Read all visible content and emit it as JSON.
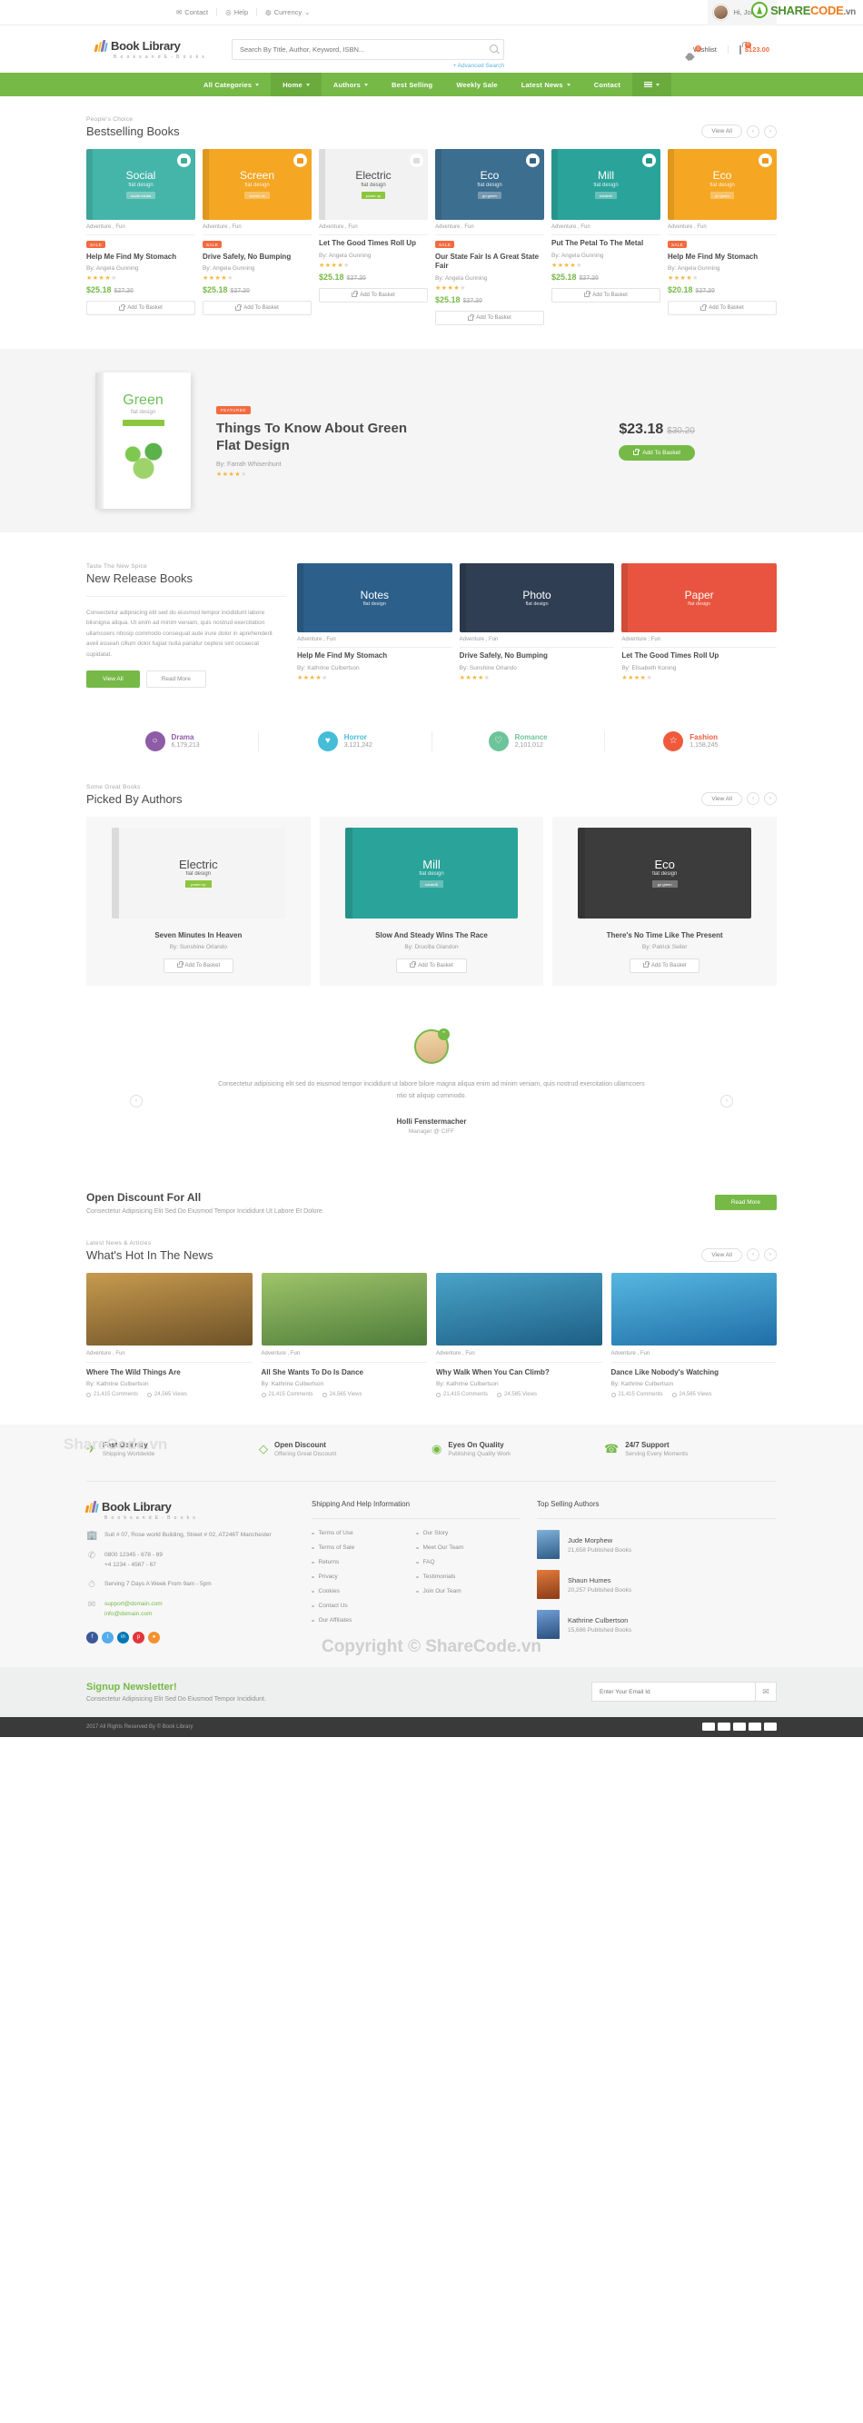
{
  "topbar": {
    "links": [
      {
        "label": "Contact",
        "icon": "envelope-icon"
      },
      {
        "label": "Help",
        "icon": "question-circle-icon"
      },
      {
        "label": "Currency",
        "icon": "globe-icon"
      }
    ],
    "user": "Hi, John",
    "sharecode": {
      "green": "SHARE",
      "orange": "CODE",
      "suffix": ".vn"
    }
  },
  "header": {
    "brand": "Book Library",
    "brand_sub": "B o o k s   a n d   E - B o o k s",
    "search_placeholder": "Search By Title, Author, Keyword, ISBN...",
    "advanced_search": "+ Advanced Search",
    "wishlist_label": "Wishlist",
    "wishlist_count": "0",
    "cart_count": "0",
    "cart_total": "$123.00"
  },
  "nav": {
    "items": [
      {
        "label": "All Categories",
        "caret": true,
        "active": false
      },
      {
        "label": "Home",
        "caret": true,
        "active": true
      },
      {
        "label": "Authors",
        "caret": true,
        "active": false
      },
      {
        "label": "Best Selling",
        "caret": false,
        "active": false
      },
      {
        "label": "Weekly Sale",
        "caret": false,
        "active": false
      },
      {
        "label": "Latest News",
        "caret": true,
        "active": false
      },
      {
        "label": "Contact",
        "caret": false,
        "active": false
      }
    ],
    "burger_caret": true
  },
  "bestselling": {
    "eyebrow": "People's Choice",
    "title": "Bestselling Books",
    "view_all": "View All",
    "prev": "‹",
    "next": "›",
    "products": [
      {
        "cover_title": "Social",
        "cover_sub": "flat design",
        "cover_badge": "social media",
        "bg": "#45b5aa",
        "badge_color": "#3fae9f",
        "category": "Adventure , Fun",
        "sale": "SALE",
        "title": "Help Me Find My Stomach",
        "author": "By: Angela Gunning",
        "rating": 4,
        "price": "$25.18",
        "old_price": "$27.20",
        "cta": "Add To Basket"
      },
      {
        "cover_title": "Screen",
        "cover_sub": "flat design",
        "cover_badge": "screen ux",
        "bg": "#f5a623",
        "badge_color": "#f0971a",
        "category": "Adventure , Fun",
        "sale": "SALE",
        "title": "Drive Safely, No Bumping",
        "author": "By: Angela Gunning",
        "rating": 4,
        "price": "$25.18",
        "old_price": "$27.20",
        "cta": "Add To Basket"
      },
      {
        "cover_title": "Electric",
        "cover_sub": "flat design",
        "cover_badge": "power up",
        "bg": "#f2f2f2",
        "badge_color": "#dcdcdc",
        "category": "Adventure , Fun",
        "sale": "",
        "title": "Let The Good Times Roll Up",
        "author": "By: Angela Gunning",
        "rating": 4,
        "price": "$25.18",
        "old_price": "$27.20",
        "cta": "Add To Basket"
      },
      {
        "cover_title": "Eco",
        "cover_sub": "flat design",
        "cover_badge": "go green",
        "bg": "#3c6e8f",
        "badge_color": "#35637f",
        "category": "Adventure , Fun",
        "sale": "SALE",
        "title": "Our State Fair Is A Great State Fair",
        "author": "By: Angela Gunning",
        "rating": 4,
        "price": "$25.18",
        "old_price": "$27.20",
        "cta": "Add To Basket"
      },
      {
        "cover_title": "Mill",
        "cover_sub": "flat design",
        "cover_badge": "windmill",
        "bg": "#2aa39a",
        "badge_color": "#25948c",
        "category": "Adventure , Fun",
        "sale": "",
        "title": "Put The Petal To The Metal",
        "author": "By: Angela Gunning",
        "rating": 4,
        "price": "$25.18",
        "old_price": "$27.20",
        "cta": "Add To Basket"
      },
      {
        "cover_title": "Eco",
        "cover_sub": "flat design",
        "cover_badge": "go green",
        "bg": "#f5a623",
        "badge_color": "#f0971a",
        "category": "Adventure , Fun",
        "sale": "SALE",
        "title": "Help Me Find My Stomach",
        "author": "By: Angela Gunning",
        "rating": 4,
        "price": "$20.18",
        "old_price": "$27.20",
        "cta": "Add To Basket"
      }
    ]
  },
  "feature": {
    "tag": "FEATURED",
    "title": "Things To Know About Green Flat Design",
    "author": "By: Farrah Whisenhunt",
    "rating": 4,
    "price": "$23.18",
    "old_price": "$30.20",
    "cta": "Add To Basket",
    "cover_title": "Green",
    "cover_sub": "flat design",
    "cover_badge": "eco friendly"
  },
  "newrelease": {
    "eyebrow": "Taste The New Spice",
    "title": "New Release Books",
    "description": "Consectetur adipisicing elit sed do eiusmod tempor incididunt labore bilonigna aliqua. Ut enim ad minim veniam, quis nostrud exercitation ullamcoers ntiosip commodo consequat aute irure dolor in aprehenderit aveli esseah cillum dolor fugiat nulla pariatur ceptesi sint occaecat cupidatat.",
    "btn_primary": "View All",
    "btn_secondary": "Read More",
    "books": [
      {
        "cover_title": "Notes",
        "cover_sub": "flat design",
        "bg": "#2c5f8a",
        "category": "Adventure , Fun",
        "title": "Help Me Find My Stomach",
        "author": "By: Kathrine Culbertson",
        "rating": 4
      },
      {
        "cover_title": "Photo",
        "cover_sub": "flat design",
        "bg": "#2f3e52",
        "category": "Adventure , Fun",
        "title": "Drive Safely, No Bumping",
        "author": "By: Sunshine Orlando",
        "rating": 4
      },
      {
        "cover_title": "Paper",
        "cover_sub": "flat design",
        "bg": "#e8543f",
        "category": "Adventure , Fun",
        "title": "Let The Good Times Roll Up",
        "author": "By: Elisabeth Koning",
        "rating": 4
      }
    ]
  },
  "stats": [
    {
      "name": "Drama",
      "count": "6,179,213",
      "color": "#8e5ba6",
      "icon": "chat-bubble-icon",
      "glyph": "○"
    },
    {
      "name": "Horror",
      "count": "3,121,242",
      "color": "#45bcd8",
      "icon": "heartbeat-icon",
      "glyph": "♥"
    },
    {
      "name": "Romance",
      "count": "2,101,012",
      "color": "#6dc49a",
      "icon": "heart-icon",
      "glyph": "♡"
    },
    {
      "name": "Fashion",
      "count": "1,158,245",
      "color": "#ef5a3d",
      "icon": "star-icon",
      "glyph": "☆"
    }
  ],
  "picked": {
    "eyebrow": "Some Great Books",
    "title": "Picked By Authors",
    "view_all": "View All",
    "books": [
      {
        "cover_title": "Electric",
        "cover_sub": "flat design",
        "cover_badge": "power up",
        "bg": "#f4f4f4",
        "title": "Seven Minutes In Heaven",
        "author": "By: Sunshine Orlando",
        "cta": "Add To Basket"
      },
      {
        "cover_title": "Mill",
        "cover_sub": "flat design",
        "cover_badge": "windmill",
        "bg": "#2aa39a",
        "title": "Slow And Steady Wins The Race",
        "author": "By: Drucilla Glandon",
        "cta": "Add To Basket"
      },
      {
        "cover_title": "Eco",
        "cover_sub": "flat design",
        "cover_badge": "go green",
        "bg": "#3c3c3c",
        "title": "There's No Time Like The Present",
        "author": "By: Patrick Seiler",
        "cta": "Add To Basket"
      }
    ]
  },
  "testimonial": {
    "quote_mark": "”",
    "text": "Consectetur adipisicing elit sed do eiusmod tempor incididunt ut labore bilore magna aliqua enim ad minim veniam, quis nostrud exercitation ullamcoers ntio sit aliquip commodo.",
    "name": "Holli Fenstermacher",
    "role": "Manager @ CIFF",
    "prev": "‹",
    "next": "›"
  },
  "discount": {
    "title": "Open Discount For All",
    "subtitle": "Consectetur Adipisicing Elit Sed Do Eiusmod Tempor Incididunt Ut Labore Et Dolore.",
    "cta": "Read More"
  },
  "news": {
    "eyebrow": "Latest News & Articles",
    "title": "What's Hot In The News",
    "view_all": "View All",
    "articles": [
      {
        "bg": "linear-gradient(170deg,#c79a4e,#6e5228)",
        "category": "Adventure , Fun",
        "title": "Where The Wild Things Are",
        "author": "By: Kathrine Culbertson",
        "comments": "21,415 Comments",
        "views": "24,565 Views"
      },
      {
        "bg": "linear-gradient(170deg,#9fc46a,#4e7c3a)",
        "category": "Adventure , Fun",
        "title": "All She Wants To Do Is Dance",
        "author": "By: Kathrine Culbertson",
        "comments": "21,415 Comments",
        "views": "24,565 Views"
      },
      {
        "bg": "linear-gradient(170deg,#4aa3c9,#1d5f85)",
        "category": "Adventure , Fun",
        "title": "Why Walk When You Can Climb?",
        "author": "By: Kathrine Culbertson",
        "comments": "21,415 Comments",
        "views": "24,565 Views"
      },
      {
        "bg": "linear-gradient(170deg,#57b7e0,#1f6fa8)",
        "category": "Adventure , Fun",
        "title": "Dance Like Nobody's Watching",
        "author": "By: Kathrine Culbertson",
        "comments": "21,415 Comments",
        "views": "24,565 Views"
      }
    ]
  },
  "services": {
    "watermark": "ShareCode.vn",
    "items": [
      {
        "icon": "rocket-icon",
        "glyph": "✈",
        "title": "Fast Delivery",
        "sub": "Shipping Worldwide"
      },
      {
        "icon": "tag-icon",
        "glyph": "◇",
        "title": "Open Discount",
        "sub": "Offering Great Discount"
      },
      {
        "icon": "eye-icon",
        "glyph": "◉",
        "title": "Eyes On Quality",
        "sub": "Publishing Quality Work"
      },
      {
        "icon": "support-icon",
        "glyph": "☎",
        "title": "24/7 Support",
        "sub": "Serving Every Moments"
      }
    ]
  },
  "footer": {
    "watermark": "Copyright © ShareCode.vn",
    "brand": "Book Library",
    "brand_sub": "B o o k s   a n d   E - B o o k s",
    "address": "Suit # 07, Rose world Building, Street # 02, AT246T Manchester",
    "phone1": "0800 12345 - 678 - 89",
    "phone2": "+4 1234 - 4567 - 67",
    "hours": "Serving 7 Days A Week From 9am - 5pm",
    "email1": "support@domain.com",
    "email2": "info@domain.com",
    "socials": [
      {
        "name": "facebook-icon",
        "glyph": "f",
        "color": "#3b5998"
      },
      {
        "name": "twitter-icon",
        "glyph": "t",
        "color": "#55acee"
      },
      {
        "name": "linkedin-icon",
        "glyph": "in",
        "color": "#0077b5"
      },
      {
        "name": "pinterest-icon",
        "glyph": "p",
        "color": "#e3353b"
      },
      {
        "name": "rss-icon",
        "glyph": "●",
        "color": "#f5922f"
      }
    ],
    "shipping_head": "Shipping And Help Information",
    "links_col1": [
      "Terms of Use",
      "Terms of Sale",
      "Returns",
      "Privacy",
      "Cookies",
      "Contact Us",
      "Our Affiliates"
    ],
    "links_col2": [
      "Our Story",
      "Meet Our Team",
      "FAQ",
      "Testimonials",
      "Join Our Team"
    ],
    "authors_head": "Top Selling Authors",
    "authors": [
      {
        "name": "Jude Morphew",
        "books": "21,658 Published Books",
        "color": "linear-gradient(170deg,#7fb0d8,#2e5c86)"
      },
      {
        "name": "Shaun Humes",
        "books": "20,257 Published Books",
        "color": "linear-gradient(170deg,#e07a3c,#8a3c18)"
      },
      {
        "name": "Kathrine Culbertson",
        "books": "15,686 Published Books",
        "color": "linear-gradient(170deg,#6f9ed6,#2b4f7d)"
      }
    ]
  },
  "signup": {
    "title": "Signup Newsletter!",
    "subtitle": "Consectetur Adipisicing Elit Sed Do Eiusmod Tempor Incididunt.",
    "placeholder": "Enter Your Email Id",
    "button_icon": "envelope-icon"
  },
  "bottom": {
    "copyright": "2017 All Rights Reserved By © Book Library",
    "cards": [
      "visa",
      "mastercard",
      "amex",
      "discover",
      "paypal"
    ]
  }
}
